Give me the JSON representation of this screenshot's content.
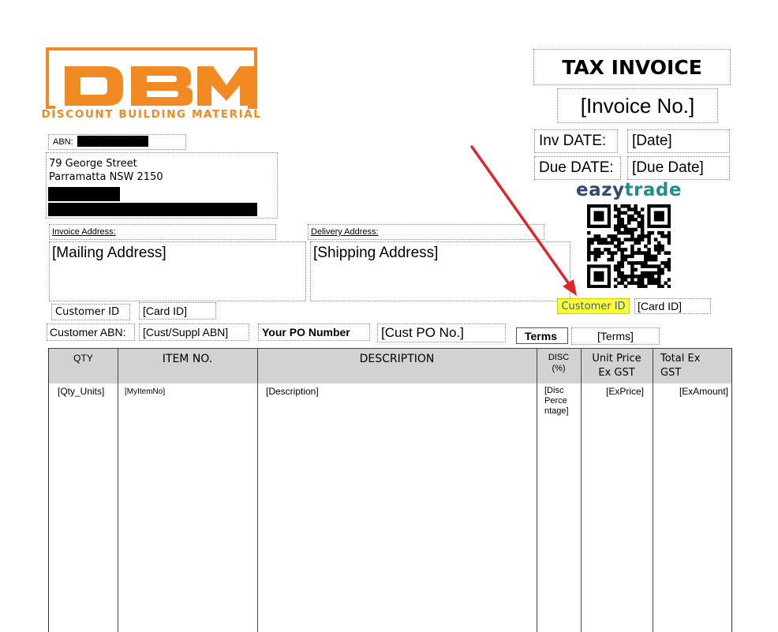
{
  "logo": {
    "letters": "DBM",
    "tagline": "DISCOUNT BUILDING MATERIAL",
    "brand_color": "#f28a24"
  },
  "header": {
    "title": "TAX INVOICE",
    "invoice_no": "[Invoice No.]",
    "inv_date_label": "Inv DATE:",
    "inv_date_value": "[Date]",
    "due_date_label": "Due DATE:",
    "due_date_value": "[Due Date]"
  },
  "eazytrade": {
    "brand_e": "eazy",
    "brand_rest": "trade",
    "qr_icon": "qr-code-icon",
    "customer_id_label": "Customer ID",
    "customer_id_value": "[Card ID]",
    "highlight_color": "#ffff33",
    "brand_color": "#1f8f8b"
  },
  "company": {
    "abn_label": "ABN:",
    "address_line1": "79 George Street",
    "address_line2": "Parramatta NSW 2150"
  },
  "addresses": {
    "invoice_label": "Invoice Address:",
    "invoice_value": "[Mailing Address]",
    "delivery_label": "Delivery Address:",
    "delivery_value": "[Shipping Address]"
  },
  "customer": {
    "id_label": "Customer ID",
    "id_value": "[Card ID]",
    "abn_label": "Customer ABN:",
    "abn_value": "[Cust/Suppl ABN]",
    "po_label": "Your PO Number",
    "po_value": "[Cust PO No.]",
    "terms_label": "Terms",
    "terms_value": "[Terms]"
  },
  "table": {
    "headers": {
      "qty": "QTY",
      "item": "ITEM NO.",
      "desc": "DESCRIPTION",
      "disc": "DISC\n(%)",
      "unit": "Unit Price\nEx GST",
      "total": "Total  Ex\nGST"
    },
    "row": {
      "qty": "[Qty_Units]",
      "item": "[MyItemNo]",
      "desc": "[Description]",
      "disc": "[Disc\nPerce\nntage]",
      "unit": "[ExPrice]",
      "total": "[ExAmount]"
    }
  },
  "annotation": {
    "arrow_color": "#e0262a"
  }
}
